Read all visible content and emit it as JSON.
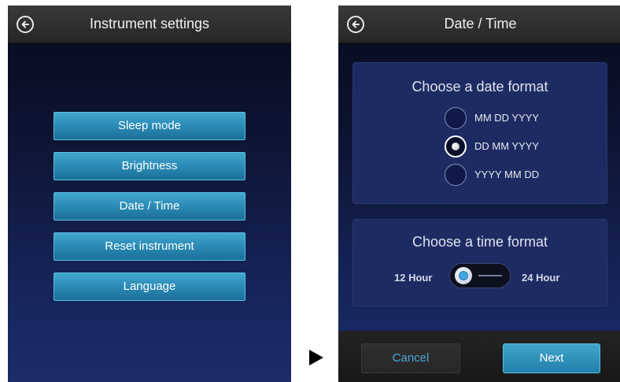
{
  "instrument_settings": {
    "title": "Instrument settings",
    "menu_items": [
      {
        "label": "Sleep mode"
      },
      {
        "label": "Brightness"
      },
      {
        "label": "Date / Time"
      },
      {
        "label": "Reset instrument"
      },
      {
        "label": "Language"
      }
    ]
  },
  "date_time": {
    "title": "Date / Time",
    "date_format": {
      "heading": "Choose a date format",
      "options": [
        {
          "label": "MM DD YYYY",
          "selected": false
        },
        {
          "label": "DD MM YYYY",
          "selected": true
        },
        {
          "label": "YYYY MM DD",
          "selected": false
        }
      ]
    },
    "time_format": {
      "heading": "Choose a time format",
      "left_label": "12 Hour",
      "right_label": "24 Hour",
      "selected": "12 Hour"
    },
    "footer": {
      "cancel_label": "Cancel",
      "next_label": "Next"
    }
  },
  "icons": {
    "back": "back-arrow-icon",
    "transition_arrow": "right-triangle-icon"
  },
  "colors": {
    "header_bg": "#2f2f2f",
    "button_blue": "#2a8ab5",
    "cancel_text": "#4aa7d6",
    "screen_bg_top": "#080b1c",
    "screen_bg_bottom": "#1b2c67"
  }
}
